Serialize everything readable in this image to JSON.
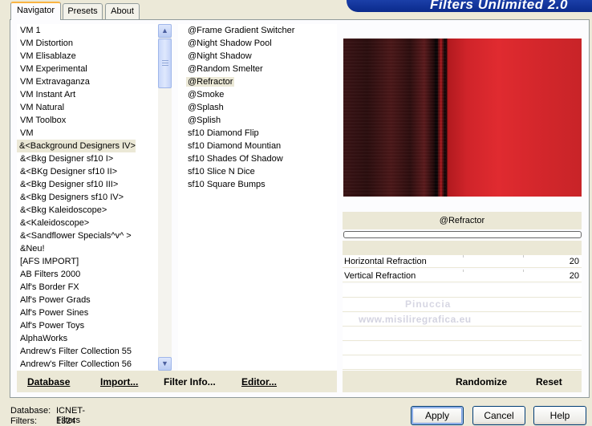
{
  "tabs": [
    {
      "label": "Navigator",
      "active": true
    },
    {
      "label": "Presets",
      "active": false
    },
    {
      "label": "About",
      "active": false
    }
  ],
  "banner_title": "Filters Unlimited 2.0",
  "categories": [
    "VM 1",
    "VM Distortion",
    "VM Elisablaze",
    "VM Experimental",
    "VM Extravaganza",
    "VM Instant Art",
    "VM Natural",
    "VM Toolbox",
    "VM",
    "&<Background Designers IV>",
    "&<Bkg Designer sf10 I>",
    "&<BKg Designer sf10 II>",
    "&<Bkg Designer sf10 III>",
    "&<Bkg Designers sf10 IV>",
    "&<Bkg Kaleidoscope>",
    "&<Kaleidoscope>",
    "&<Sandflower Specials^v^ >",
    "&Neu!",
    "[AFS IMPORT]",
    "AB Filters 2000",
    "Alf's Border FX",
    "Alf's Power Grads",
    "Alf's Power Sines",
    "Alf's Power Toys",
    "AlphaWorks",
    "Andrew's Filter Collection 55",
    "Andrew's Filter Collection 56"
  ],
  "selected_category_index": 9,
  "filters": [
    "@Frame Gradient Switcher",
    "@Night Shadow Pool",
    "@Night Shadow",
    "@Random Smelter",
    "@Refractor",
    "@Smoke",
    "@Splash",
    "@Splish",
    "sf10 Diamond Flip",
    "sf10 Diamond Mountian",
    "sf10 Shades Of Shadow",
    "sf10 Slice N Dice",
    "sf10 Square Bumps"
  ],
  "selected_filter_index": 4,
  "left_buttons": {
    "database": "Database",
    "import": "Import...",
    "filter_info": "Filter Info...",
    "editor": "Editor..."
  },
  "current_filter_name": "@Refractor",
  "parameters": [
    {
      "label": "Horizontal Refraction",
      "value": "20"
    },
    {
      "label": "Vertical Refraction",
      "value": "20"
    }
  ],
  "watermark": {
    "line1": "Pinuccia",
    "line2": "www.misiliregrafica.eu"
  },
  "right_buttons": {
    "randomize": "Randomize",
    "reset": "Reset"
  },
  "status": {
    "database_label": "Database:",
    "database_value": "ICNET-Filters",
    "filters_label": "Filters:",
    "filters_value": "1324"
  },
  "dialog_buttons": {
    "apply": "Apply",
    "cancel": "Cancel",
    "help": "Help"
  }
}
